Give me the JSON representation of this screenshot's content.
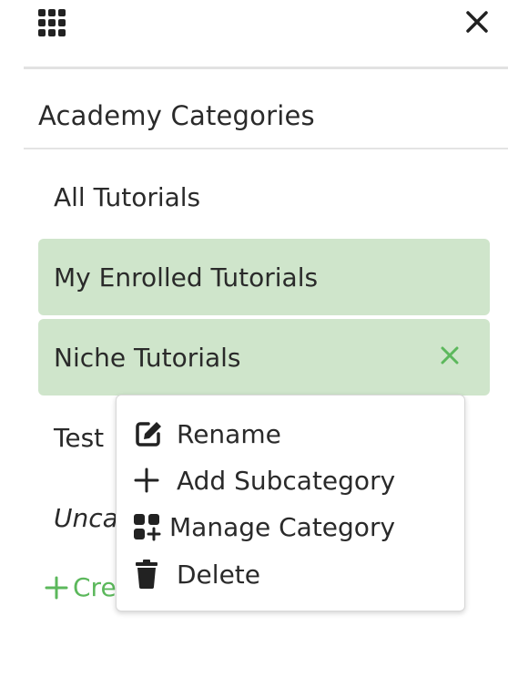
{
  "header": {
    "apps_icon": "grid-icon",
    "close_icon": "close-icon"
  },
  "sidebar": {
    "heading": "Academy Categories",
    "items": [
      {
        "label": "All Tutorials"
      },
      {
        "label": "My Enrolled Tutorials"
      },
      {
        "label": "Niche Tutorials"
      },
      {
        "label": "Test"
      },
      {
        "label": "Unca"
      }
    ],
    "create_label": "Cre"
  },
  "context_menu": {
    "items": [
      {
        "label": "Rename",
        "icon": "edit-icon"
      },
      {
        "label": "Add Subcategory",
        "icon": "plus-icon"
      },
      {
        "label": "Manage Category",
        "icon": "manage-icon"
      },
      {
        "label": "Delete",
        "icon": "trash-icon"
      }
    ]
  },
  "colors": {
    "selected_bg": "#cfe5cb",
    "accent_green": "#5cb85c",
    "text": "#2a2a2a"
  }
}
